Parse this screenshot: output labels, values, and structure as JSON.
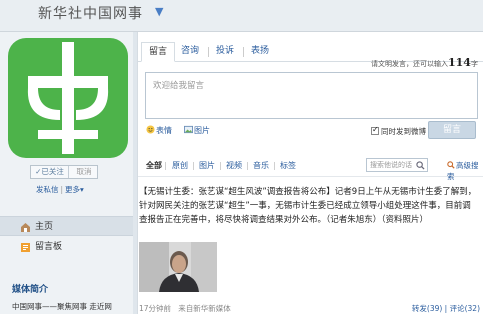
{
  "header": {
    "site_name": "新华社中国网事",
    "title_arrow": "▼"
  },
  "profile": {
    "logo_icon": "zhong-logo",
    "brand_green": "#4db34a",
    "followed_label": "✓已关注",
    "cancel_label": "取消",
    "send_private_message": "发私信",
    "more_label": "更多▾"
  },
  "left_nav": {
    "items": [
      {
        "label": "主页",
        "icon": "home-icon"
      },
      {
        "label": "留言板",
        "icon": "message-board-icon"
      }
    ]
  },
  "media": {
    "title": "媒体简介",
    "description": "中国网事——聚焦网事 走近网"
  },
  "composer": {
    "tabs": [
      "留言",
      "咨询",
      "投诉",
      "表扬"
    ],
    "hint_prefix": "请文明发言，还可以输入",
    "hint_count": "114",
    "hint_suffix": "字",
    "placeholder": "欢迎给我留言",
    "emoji_label": "表情",
    "image_label": "图片",
    "sync_label": "同时发到微博",
    "submit_label": "留言"
  },
  "filters": {
    "items": [
      "全部",
      "原创",
      "图片",
      "视频",
      "音乐",
      "标签"
    ],
    "search_placeholder": "搜索他说的话",
    "advanced_search": "高级搜索"
  },
  "post": {
    "text": "【无锡计生委：张艺谋“超生风波”调查报告将公布】记者9日上午从无锡市计生委了解到，针对网民关注的张艺谋“超生”一事，无锡市计生委已经成立领导小组处理这件事，目前调查报告正在完善中，将尽快将调查结果对外公布。（记者朱旭东）（资料照片）",
    "time": "17分钟前",
    "source": "来自新华新媒体",
    "repost": "转发(39)",
    "comment": "评论(32)"
  }
}
